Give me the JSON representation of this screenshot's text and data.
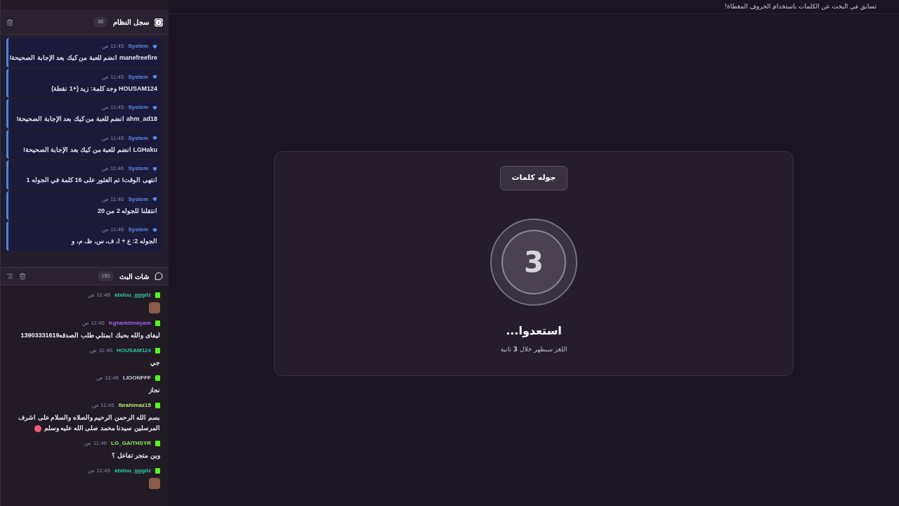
{
  "header": {
    "subtitle": "تسابق في البحث عن الكلمات باستخدام الحروف المعطاة!"
  },
  "system_log": {
    "title": "سجل النظام",
    "count": "88",
    "entries": [
      {
        "sender": "System",
        "time": "11:45 ص",
        "text": "manefreefire انضم للعبة من كيك بعد الإجابة الصحيحة!"
      },
      {
        "sender": "System",
        "time": "11:45 ص",
        "text": "HOUSAM124 وجد كلمة: زيد (+1 نقطة)"
      },
      {
        "sender": "System",
        "time": "11:45 ص",
        "text": "ahm_ad18 انضم للعبة من كيك بعد الإجابة الصحيحة!"
      },
      {
        "sender": "System",
        "time": "11:45 ص",
        "text": "LGHaku انضم للعبة من كيك بعد الإجابة الصحيحة!"
      },
      {
        "sender": "System",
        "time": "11:46 ص",
        "text": "انتهى الوقت! تم العثور على 16 كلمة في الجوله 1"
      },
      {
        "sender": "System",
        "time": "11:46 ص",
        "text": "انتقلنا للجوله 2 من 20"
      },
      {
        "sender": "System",
        "time": "11:46 ص",
        "text": "الجوله 2: ع + ا، ف، س، ظ، م، و"
      }
    ]
  },
  "chat": {
    "title": "شات البث",
    "count": "150",
    "messages": [
      {
        "kind": "sticker",
        "user": "abdou_gggdz",
        "color": "#2cc7a0",
        "time": "11:46 ص"
      },
      {
        "kind": "text",
        "user": "Kgharktimayam",
        "color": "#a45cf0",
        "time": "11:46 ص",
        "text": "ليفاى والله بحبك ابمتلي طلب الصدقه13903331619"
      },
      {
        "kind": "text",
        "user": "HOUSAM124",
        "color": "#23c49a",
        "time": "11:46 ص",
        "text": "جي"
      },
      {
        "kind": "text",
        "user": "LIOONFFF",
        "color": "#c3cbe8",
        "time": "11:46 ص",
        "text": "نجاز"
      },
      {
        "kind": "text",
        "user": "Ibrahimaz15",
        "color": "#b5e86b",
        "time": "11:46 ص",
        "text": "بسم الله الرحمن الرحيم والصلاه والسلام على اشرف المرسلين سيدنا محمد صلى الله عليه وسلم",
        "emote": true
      },
      {
        "kind": "text",
        "user": "LG_GAITHSYR",
        "color": "#8ee85a",
        "time": "11:46 ص",
        "text": "وين متجر تفاعل ؟"
      },
      {
        "kind": "sticker",
        "user": "abdou_gggdz",
        "color": "#2cc7a0",
        "time": "11:46 ص"
      }
    ]
  },
  "round_card": {
    "badge": "جوله كلمات",
    "countdown": "3",
    "title": "استعدوا...",
    "note": "اللغز سيظهر خلال **3** ثانية"
  }
}
